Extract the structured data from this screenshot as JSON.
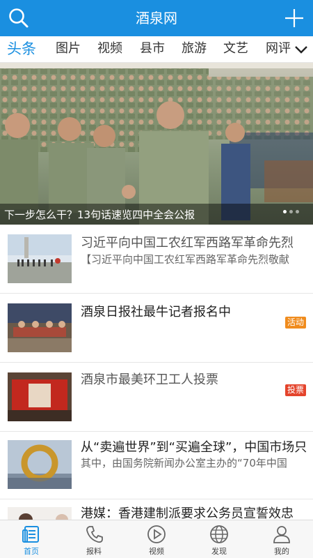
{
  "header": {
    "title": "酒泉网",
    "search_icon": "search-icon",
    "add_icon": "plus-icon",
    "bg_color": "#1a8fe0"
  },
  "tabs": {
    "items": [
      {
        "label": "头条",
        "active": true
      },
      {
        "label": "图片"
      },
      {
        "label": "视频"
      },
      {
        "label": "县市"
      },
      {
        "label": "旅游"
      },
      {
        "label": "文艺"
      },
      {
        "label": "网评"
      }
    ],
    "more_icon": "chevron-down-icon"
  },
  "banner": {
    "caption": "下一步怎么干？13句话速览四中全会公报",
    "slide_count": 3,
    "active_slide": 1
  },
  "news": [
    {
      "title": "习近平向中国工农红军西路军革命先烈",
      "subtitle": "【习近平向中国工农红军西路军革命先烈敬献"
    },
    {
      "title": "酒泉日报社最牛记者报名中",
      "badge": "活动",
      "badge_color": "#f08c1e"
    },
    {
      "title": "酒泉市最美环卫工人投票",
      "badge": "投票",
      "badge_color": "#e4442c"
    },
    {
      "title": "从“卖遍世界”到“买遍全球”，中国市场只",
      "subtitle": "其中，由国务院新闻办公室主办的“70年中国"
    },
    {
      "title": "港媒：香港建制派要求公务员宣誓效忠"
    }
  ],
  "bottom_nav": {
    "items": [
      {
        "label": "首页",
        "icon": "home-news-icon",
        "active": true
      },
      {
        "label": "报料",
        "icon": "phone-icon"
      },
      {
        "label": "视频",
        "icon": "play-icon"
      },
      {
        "label": "发现",
        "icon": "globe-icon"
      },
      {
        "label": "我的",
        "icon": "user-icon"
      }
    ],
    "active_color": "#1a8fe0"
  }
}
